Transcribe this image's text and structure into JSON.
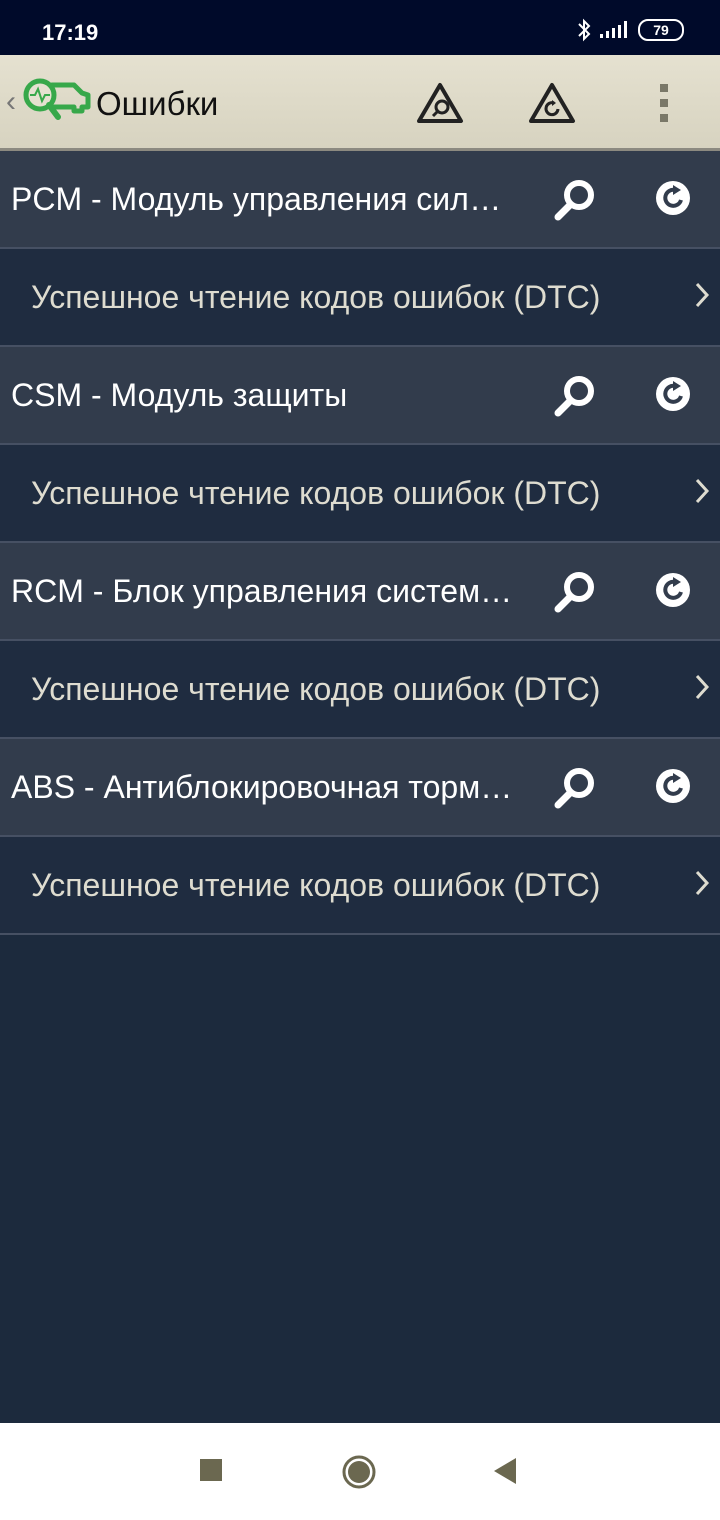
{
  "status_bar": {
    "time": "17:19",
    "battery": "79"
  },
  "toolbar": {
    "title": "Ошибки"
  },
  "modules": [
    {
      "name": "PCM - Модуль управления силовым агрегатом",
      "status": "Успешное чтение кодов ошибок (DTC)"
    },
    {
      "name": "CSM - Модуль защиты",
      "status": "Успешное чтение кодов ошибок (DTC)"
    },
    {
      "name": "RCM - Блок управления системой безопасности",
      "status": "Успешное чтение кодов ошибок (DTC)"
    },
    {
      "name": "ABS - Антиблокировочная тормозная система",
      "status": "Успешное чтение кодов ошибок (DTC)"
    }
  ],
  "colors": {
    "accent_green": "#37a84a",
    "header_row": "#323c4c",
    "sub_row": "#1f2c40"
  }
}
